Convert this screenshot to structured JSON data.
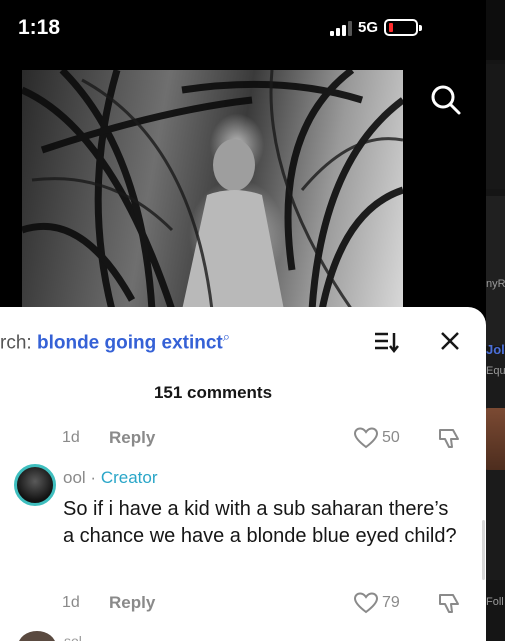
{
  "status": {
    "time": "1:18",
    "network": "5G"
  },
  "search": {
    "prefix": "rch:",
    "term": "blonde going extinct"
  },
  "comments": {
    "count_label": "151 comments",
    "prev_meta": {
      "age": "1d",
      "reply": "Reply",
      "likes": "50"
    },
    "comment": {
      "author": "ool",
      "separator": "·",
      "role": "Creator",
      "text": "So if i have a kid with a sub saharan there’s a chance we have a blonde blue eyed child?",
      "age": "1d",
      "reply": "Reply",
      "likes": "79"
    },
    "next_author": "sol"
  },
  "peek": {
    "text1": "nyRa",
    "text2": "Jol",
    "text3": "Equ",
    "text4": "Foll"
  },
  "colors": {
    "accent_blue": "#3561d6",
    "creator": "#2aa6c8",
    "avatar_ring": "#3fbfbf",
    "battery_low": "#ff2d2d"
  }
}
